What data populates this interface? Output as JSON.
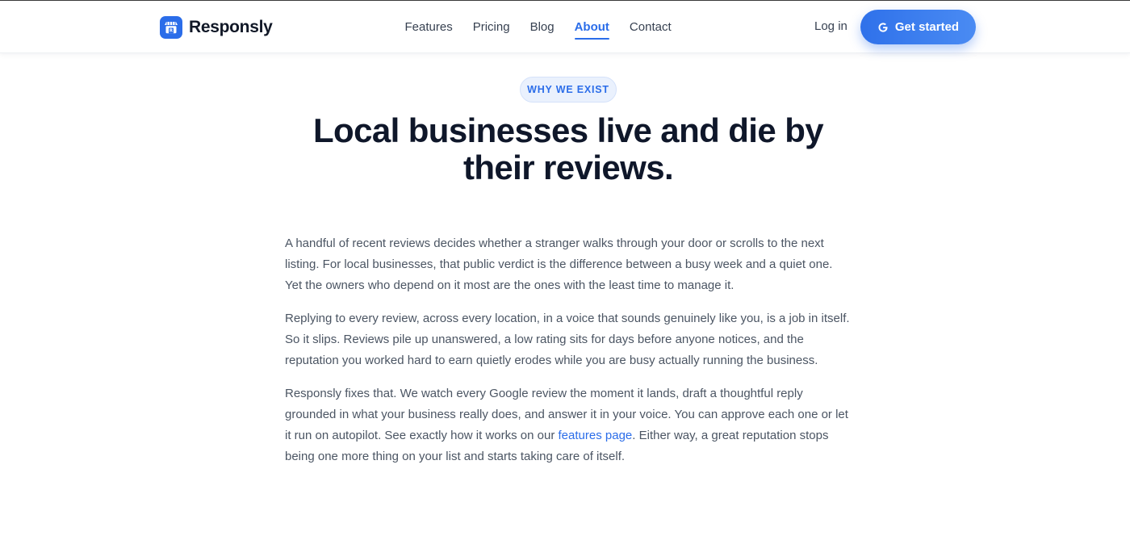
{
  "header": {
    "brand": "Responsly",
    "nav": [
      {
        "label": "Features",
        "active": false
      },
      {
        "label": "Pricing",
        "active": false
      },
      {
        "label": "Blog",
        "active": false
      },
      {
        "label": "About",
        "active": true
      },
      {
        "label": "Contact",
        "active": false
      }
    ],
    "login_label": "Log in",
    "cta_label": "Get started"
  },
  "hero": {
    "badge": "WHY WE EXIST",
    "headline_line1": "Local businesses live and die by",
    "headline_line2": "their reviews."
  },
  "body": {
    "p1": "A handful of recent reviews decides whether a stranger walks through your door or scrolls to the next listing. For local businesses, that public verdict is the difference between a busy week and a quiet one. Yet the owners who depend on it most are the ones with the least time to manage it.",
    "p2": "Replying to every review, across every location, in a voice that sounds genuinely like you, is a job in itself. So it slips. Reviews pile up unanswered, a low rating sits for days before anyone notices, and the reputation you worked hard to earn quietly erodes while you are busy actually running the business.",
    "p3_before": "Responsly fixes that. We watch every Google review the moment it lands, draft a thoughtful reply grounded in what your business really does, and answer it in your voice. You can approve each one or let it run on autopilot. See exactly how it works on our ",
    "p3_link": "features page",
    "p3_after": ". Either way, a great reputation stops being one more thing on your list and starts taking care of itself."
  },
  "colors": {
    "accent": "#2b6de9",
    "heading": "#0f172a",
    "body_text": "#4b5563",
    "badge_bg": "#eaf1fd"
  },
  "icons": {
    "brand": "storefront-icon",
    "cta": "google-icon"
  }
}
